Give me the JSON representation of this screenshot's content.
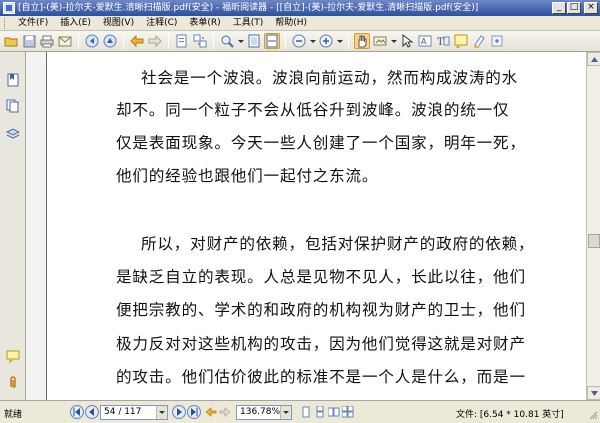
{
  "window": {
    "title": "[自立]-(美)-拉尔夫-爱默生.清晰扫描版.pdf(安全) - 福昕阅读器 - [[自立]-(美)-拉尔夫-爱默生.清晰扫描版.pdf(安全)]"
  },
  "menu": {
    "items": [
      "文件(F)",
      "插入(E)",
      "视图(V)",
      "注释(C)",
      "表单(R)",
      "工具(T)",
      "帮助(H)"
    ]
  },
  "toolbar": {
    "icons": [
      "open-folder-icon",
      "save-icon",
      "print-icon",
      "email-icon",
      "first-page-icon",
      "previous-page-icon",
      "back-icon",
      "forward-icon",
      "single-page-icon",
      "continuous-page-icon",
      "zoom-icon",
      "fit-page-icon",
      "fit-width-icon",
      "zoom-out-icon",
      "zoom-in-icon",
      "hand-tool-icon",
      "snapshot-icon",
      "select-icon",
      "text-select-icon",
      "typewriter-icon",
      "note-icon",
      "highlight-icon",
      "more-icon"
    ]
  },
  "document": {
    "paragraph1": [
      "社会是一个波浪。波浪向前运动，然而构成波涛的水",
      "却不。同一个粒子不会从低谷升到波峰。波浪的统一仅",
      "仅是表面现象。今天一些人创建了一个国家，明年一死，",
      "他们的经验也跟他们一起付之东流。"
    ],
    "paragraph2": [
      "所以，对财产的依赖，包括对保护财产的政府的依赖，",
      "是缺乏自立的表现。人总是见物不见人，长此以往，他们",
      "便把宗教的、学术的和政府的机构视为财产的卫士，他们",
      "极力反对对这些机构的攻击，因为他们觉得这就是对财产",
      "的攻击。他们估价彼此的标准不是一个人是什么，而是一"
    ]
  },
  "statusbar": {
    "status": "就绪",
    "page_field": "54 / 117",
    "zoom_field": "136.78%",
    "doc_size": "文件: [6.54 * 10.81 英寸]"
  }
}
